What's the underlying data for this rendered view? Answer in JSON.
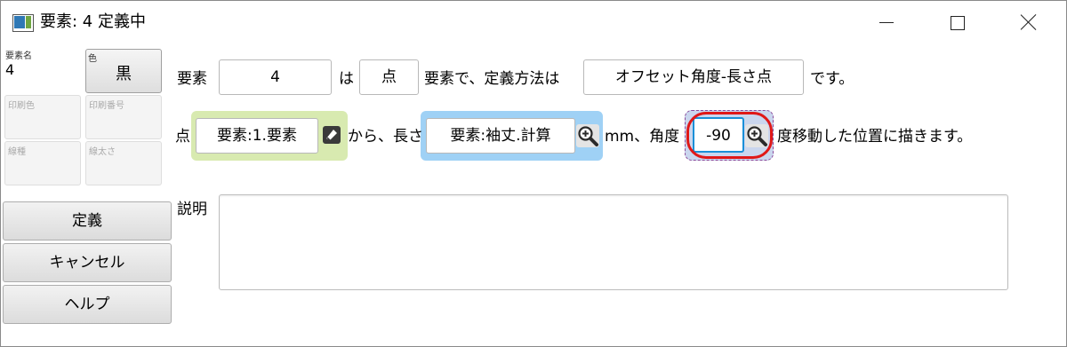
{
  "window": {
    "title": "要素: 4 定義中",
    "controls": [
      "minimize",
      "maximize",
      "close"
    ]
  },
  "left_panel": {
    "element_name_label": "要素名",
    "element_name_value": "4",
    "color_label": "色",
    "color_value": "黒",
    "print_color_label": "印刷色",
    "print_number_label": "印刷番号",
    "line_type_label": "線種",
    "line_width_label": "線太さ",
    "buttons": {
      "define": "定義",
      "cancel": "キャンセル",
      "help": "ヘルプ"
    }
  },
  "definition": {
    "element_label": "要素",
    "element_value": "4",
    "wa": "は",
    "type_value": "点",
    "element_de_text": "要素で、定義方法は",
    "method_value": "オフセット角度-長さ点",
    "desu": "です。"
  },
  "offset": {
    "point_label": "点",
    "point_value": "要素:1.要素",
    "from_length_text": "から、長さ",
    "length_value": "要素:袖丈.計算",
    "mm_angle_text": "mm、角度",
    "angle_value": "-90",
    "suffix_text": "度移動した位置に描きます。"
  },
  "description": {
    "label": "説明",
    "value": ""
  },
  "colors": {
    "point_group_bg": "#d8eab0",
    "length_group_bg": "#9fd1f5",
    "angle_highlight": "#e01818",
    "angle_focus_border": "#1a8fd8"
  },
  "icons": [
    "app-icon",
    "minimize-icon",
    "maximize-icon",
    "close-icon",
    "pick-element-icon",
    "zoom-icon"
  ]
}
